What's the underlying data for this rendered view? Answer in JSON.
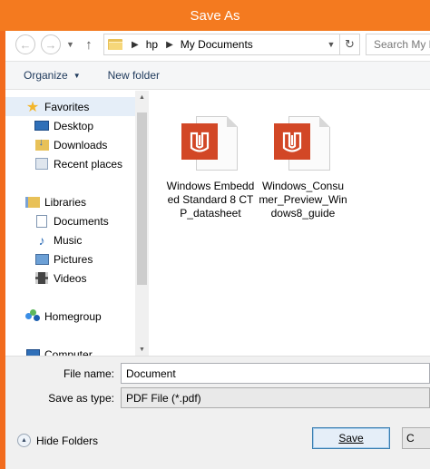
{
  "window": {
    "title": "Save As"
  },
  "address": {
    "back_glyph": "←",
    "forward_glyph": "→",
    "up_glyph": "↑",
    "crumbs": [
      "hp",
      "My Documents"
    ],
    "refresh_glyph": "↻",
    "search_placeholder": "Search My D"
  },
  "toolbar": {
    "organize_label": "Organize",
    "new_folder_label": "New folder"
  },
  "sidebar": {
    "items": [
      {
        "label": "Favorites",
        "icon": "star-icon"
      },
      {
        "label": "Desktop",
        "icon": "desktop-icon"
      },
      {
        "label": "Downloads",
        "icon": "downloads-icon"
      },
      {
        "label": "Recent places",
        "icon": "recent-places-icon"
      },
      {
        "label": "Libraries",
        "icon": "libraries-icon"
      },
      {
        "label": "Documents",
        "icon": "documents-icon"
      },
      {
        "label": "Music",
        "icon": "music-icon"
      },
      {
        "label": "Pictures",
        "icon": "pictures-icon"
      },
      {
        "label": "Videos",
        "icon": "videos-icon"
      },
      {
        "label": "Homegroup",
        "icon": "homegroup-icon"
      },
      {
        "label": "Computer",
        "icon": "computer-icon"
      }
    ]
  },
  "files": [
    {
      "name": "Windows Embedded Standard 8 CTP_datasheet",
      "icon": "pdf-reader-icon"
    },
    {
      "name": "Windows_Consumer_Preview_Windows8_guide",
      "icon": "pdf-reader-icon"
    }
  ],
  "form": {
    "file_name_label": "File name:",
    "file_name_value": "Document",
    "save_type_label": "Save as type:",
    "save_type_value": "PDF File (*.pdf)"
  },
  "footer": {
    "hide_folders_label": "Hide Folders",
    "save_label": "Save",
    "cancel_label": "C"
  },
  "colors": {
    "titlebar": "#f47a1f",
    "pdf_tile": "#d24726",
    "selection": "#e5eef8"
  }
}
